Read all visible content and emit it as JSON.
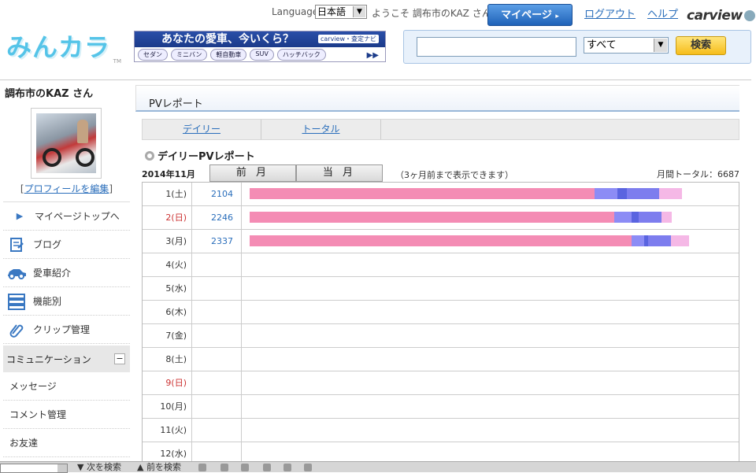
{
  "header": {
    "language_label": "Language",
    "language_value": "日本語",
    "welcome": "ようこそ 調布市のKAZ さん",
    "mypage_button": "マイページ",
    "logout": "ログアウト",
    "help": "ヘルプ",
    "carview_logo": "carview",
    "site_logo": "みんカラ",
    "site_logo_tm": "TM"
  },
  "banner": {
    "headline": "あなたの愛車、今いくら？",
    "brand": "carview・査定ナビ",
    "categories": [
      "セダン",
      "ミニバン",
      "軽自動車",
      "SUV",
      "ハッチバック"
    ]
  },
  "search": {
    "placeholder": "",
    "category_value": "すべて",
    "button": "検索"
  },
  "sidebar": {
    "username": "調布市のKAZ さん",
    "edit_profile_prefix": "[",
    "edit_profile_link": "プロフィールを編集",
    "edit_profile_suffix": "]",
    "items": [
      {
        "label": "マイページトップへ",
        "icon": "triangle-right-icon"
      },
      {
        "label": "ブログ",
        "icon": "notepad-icon"
      },
      {
        "label": "愛車紹介",
        "icon": "car-icon"
      },
      {
        "label": "機能別",
        "icon": "list-icon"
      },
      {
        "label": "クリップ管理",
        "icon": "paperclip-icon"
      }
    ],
    "section": "コミュニケーション",
    "sub_items": [
      "メッセージ",
      "コメント管理",
      "お友達"
    ]
  },
  "main": {
    "panel_title": "PVレポート",
    "tabs": [
      "デイリー",
      "トータル"
    ],
    "section_title": "デイリーPVレポート",
    "month_label": "2014年11月",
    "prev_month": "前 月",
    "current_month": "当 月",
    "note": "（3ヶ月前まで表示できます）",
    "monthly_total": "月間トータル：6687"
  },
  "report_rows": [
    {
      "day": "1(土)",
      "count": "2104",
      "red": false
    },
    {
      "day": "2(日)",
      "count": "2246",
      "red": true
    },
    {
      "day": "3(月)",
      "count": "2337",
      "red": false
    },
    {
      "day": "4(火)",
      "count": "",
      "red": false
    },
    {
      "day": "5(水)",
      "count": "",
      "red": false
    },
    {
      "day": "6(木)",
      "count": "",
      "red": false
    },
    {
      "day": "7(金)",
      "count": "",
      "red": false
    },
    {
      "day": "8(土)",
      "count": "",
      "red": false
    },
    {
      "day": "9(日)",
      "count": "",
      "red": true
    },
    {
      "day": "10(月)",
      "count": "",
      "red": false
    },
    {
      "day": "11(火)",
      "count": "",
      "red": false
    },
    {
      "day": "12(水)",
      "count": "",
      "red": false
    }
  ],
  "bar_values": [
    {
      "segments": [
        1836,
        120,
        52,
        170,
        120
      ],
      "colors": [
        "#f48cb4",
        "#8c8cf5",
        "#5a64e0",
        "#7d7dee",
        "#f5b8e6"
      ]
    },
    {
      "segments": [
        1940,
        90,
        40,
        120,
        56
      ],
      "colors": [
        "#f48cb4",
        "#8c8cf5",
        "#5a64e0",
        "#7d7dee",
        "#f5b8e6"
      ]
    },
    {
      "segments": [
        2030,
        70,
        20,
        120,
        97
      ],
      "colors": [
        "#f48cb4",
        "#8c8cf5",
        "#5a64e0",
        "#7d7dee",
        "#f5b8e6"
      ]
    }
  ],
  "findbar": {
    "next": "次を検索",
    "prev": "前を検索"
  }
}
